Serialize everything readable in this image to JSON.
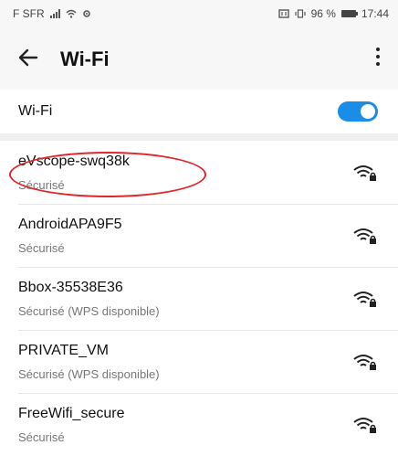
{
  "status": {
    "carrier": "F SFR",
    "battery_text": "96 %",
    "time": "17:44"
  },
  "app_bar": {
    "title": "Wi-Fi"
  },
  "wifi_toggle": {
    "label": "Wi-Fi",
    "enabled": true,
    "color": "#1a8ee6"
  },
  "networks": [
    {
      "ssid": "eVscope-swq38k",
      "security": "Sécurisé",
      "icon": "wifi-lock-icon"
    },
    {
      "ssid": "AndroidAPA9F5",
      "security": "Sécurisé",
      "icon": "wifi-lock-icon"
    },
    {
      "ssid": "Bbox-35538E36",
      "security": "Sécurisé (WPS disponible)",
      "icon": "wifi-lock-icon"
    },
    {
      "ssid": "PRIVATE_VM",
      "security": "Sécurisé (WPS disponible)",
      "icon": "wifi-lock-icon"
    },
    {
      "ssid": "FreeWifi_secure",
      "security": "Sécurisé",
      "icon": "wifi-lock-icon"
    }
  ],
  "annotation": {
    "color": "#e0262b"
  }
}
